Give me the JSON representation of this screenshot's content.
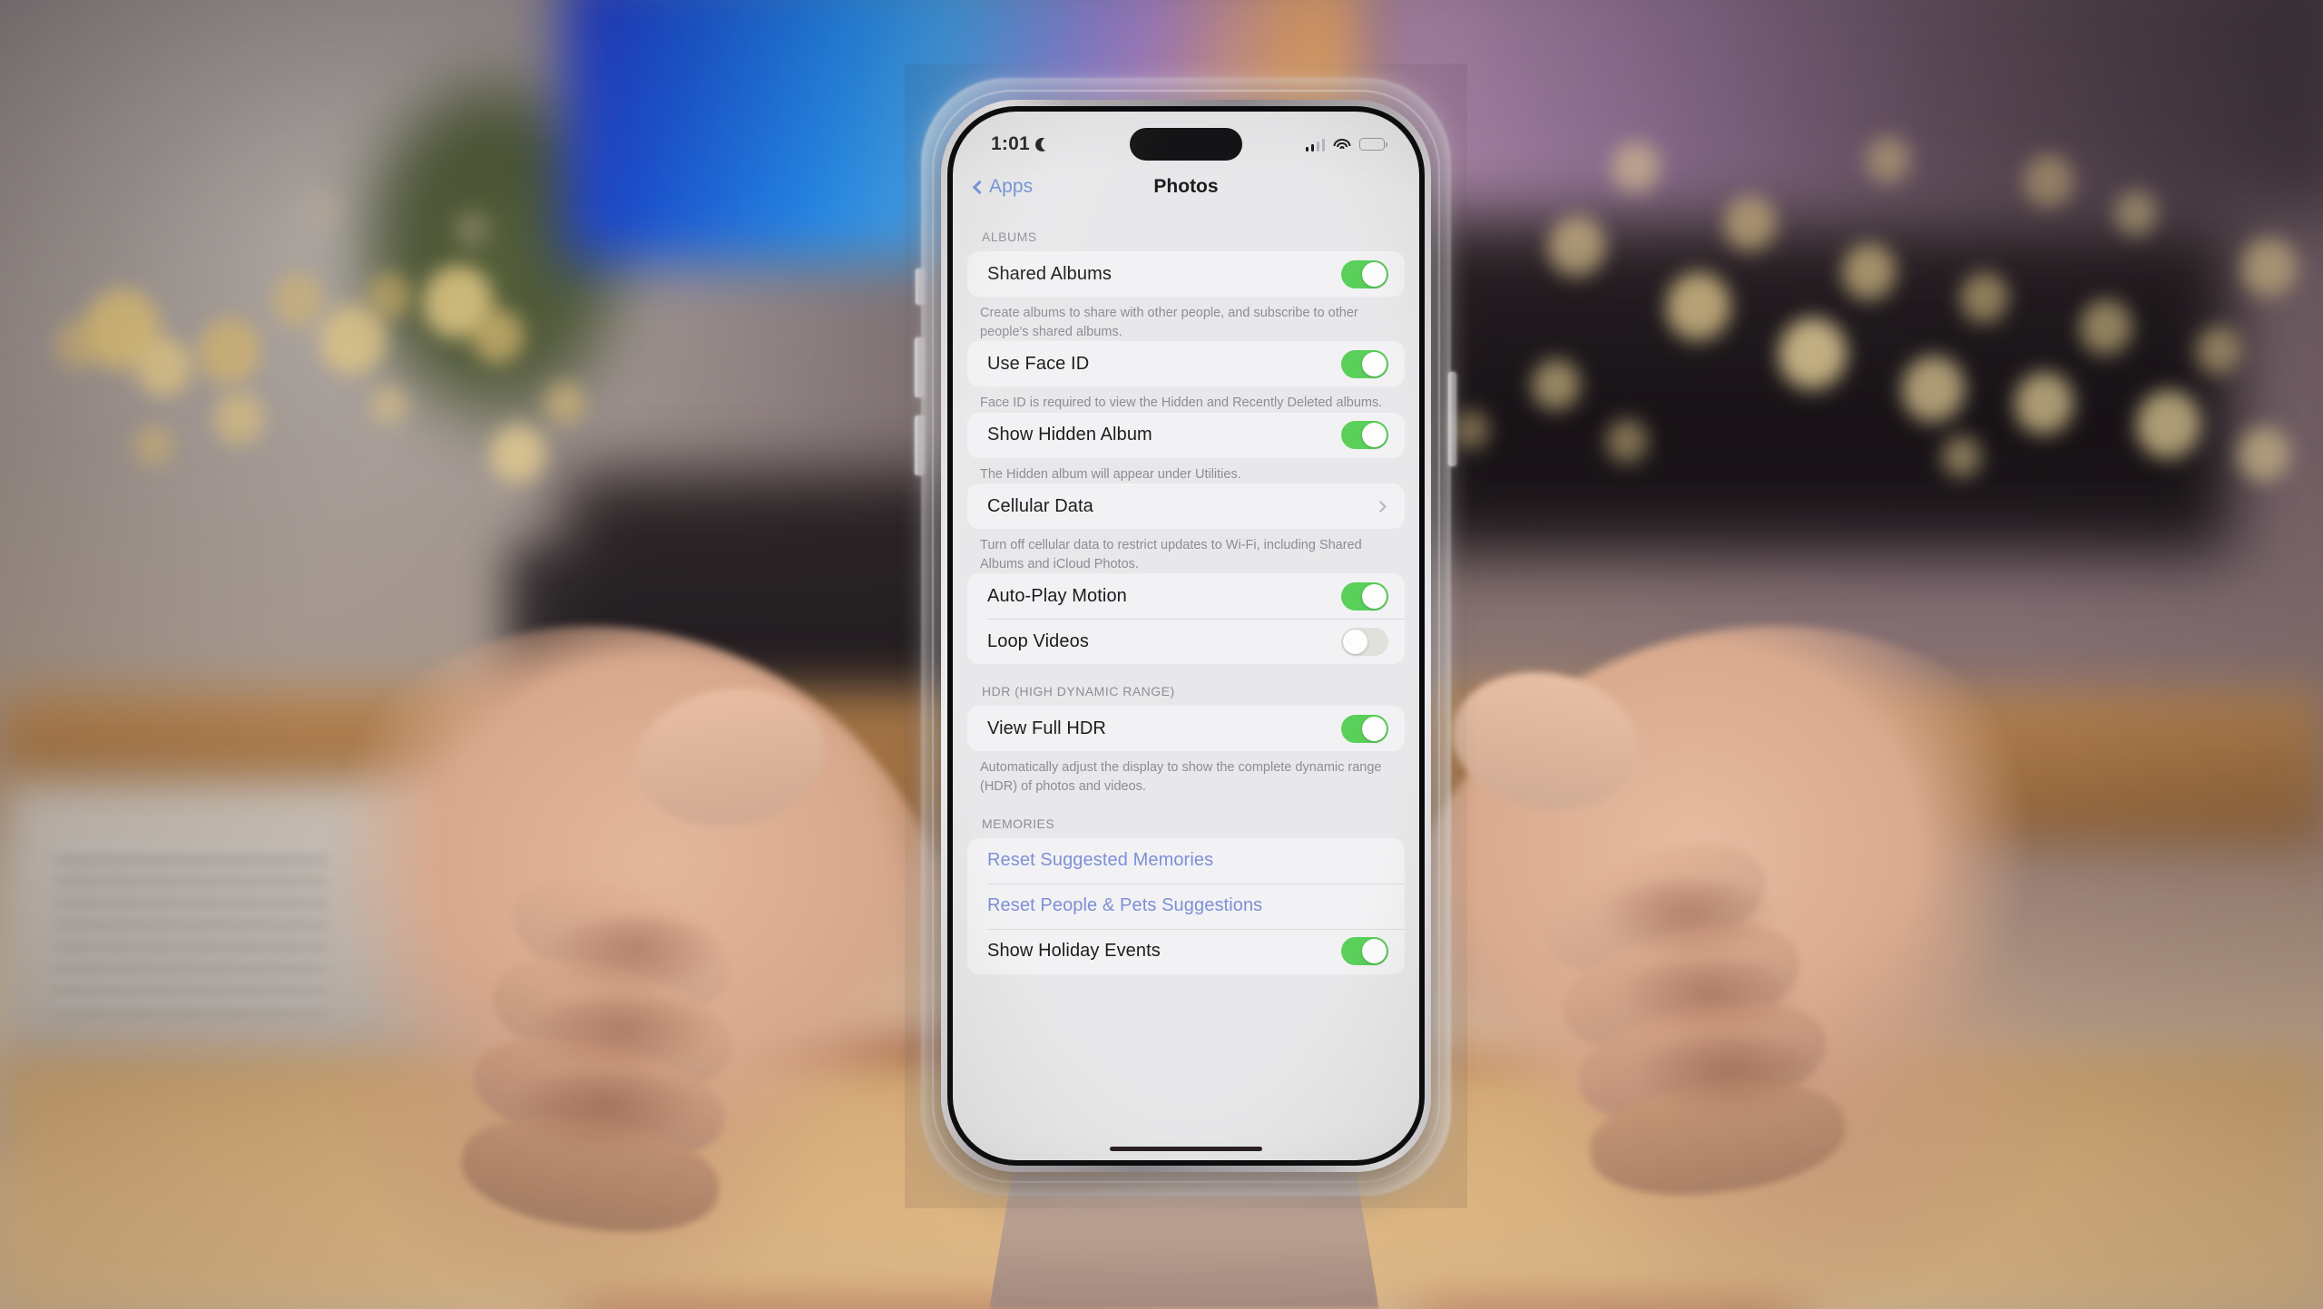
{
  "scene": {
    "description": "Hands holding an iPhone in a clear case displaying the iOS Photos settings screen, blurred living-room background with bokeh lights",
    "accent_blue": "#6e8fd6",
    "toggle_on_color": "#5ad05a",
    "toggle_off_color": "#dfe2dc",
    "link_color": "#7d8fd6"
  },
  "status_bar": {
    "time": "1:01",
    "do_not_disturb_icon": "moon-icon",
    "cellular_icon": "signal-bars-icon",
    "cellular_bars_filled": 2,
    "cellular_bars_total": 4,
    "wifi_icon": "wifi-icon",
    "battery_icon": "battery-icon",
    "battery_level_percent": 34
  },
  "nav": {
    "back_icon": "chevron-left-icon",
    "back_label": "Apps",
    "title": "Photos"
  },
  "sections": [
    {
      "header": "ALBUMS",
      "groups": [
        {
          "rows": [
            {
              "label": "Shared Albums",
              "control": "toggle",
              "state": "on"
            }
          ],
          "footnote": "Create albums to share with other people, and subscribe to other people's shared albums."
        },
        {
          "rows": [
            {
              "label": "Use Face ID",
              "control": "toggle",
              "state": "on"
            }
          ],
          "footnote": "Face ID is required to view the Hidden and Recently Deleted albums."
        },
        {
          "rows": [
            {
              "label": "Show Hidden Album",
              "control": "toggle",
              "state": "on"
            }
          ],
          "footnote": "The Hidden album will appear under Utilities."
        },
        {
          "rows": [
            {
              "label": "Cellular Data",
              "control": "disclosure",
              "state": ""
            }
          ],
          "footnote": "Turn off cellular data to restrict updates to Wi-Fi, including Shared Albums and iCloud Photos."
        },
        {
          "rows": [
            {
              "label": "Auto-Play Motion",
              "control": "toggle",
              "state": "on"
            },
            {
              "label": "Loop Videos",
              "control": "toggle",
              "state": "off"
            }
          ],
          "footnote": ""
        }
      ]
    },
    {
      "header": "HDR (HIGH DYNAMIC RANGE)",
      "groups": [
        {
          "rows": [
            {
              "label": "View Full HDR",
              "control": "toggle",
              "state": "on"
            }
          ],
          "footnote": "Automatically adjust the display to show the complete dynamic range (HDR) of photos and videos."
        }
      ]
    },
    {
      "header": "MEMORIES",
      "groups": [
        {
          "rows": [
            {
              "label": "Reset Suggested Memories",
              "control": "link",
              "state": ""
            },
            {
              "label": "Reset People & Pets Suggestions",
              "control": "link",
              "state": ""
            },
            {
              "label": "Show Holiday Events",
              "control": "toggle",
              "state": "on"
            }
          ],
          "footnote": ""
        }
      ]
    }
  ]
}
